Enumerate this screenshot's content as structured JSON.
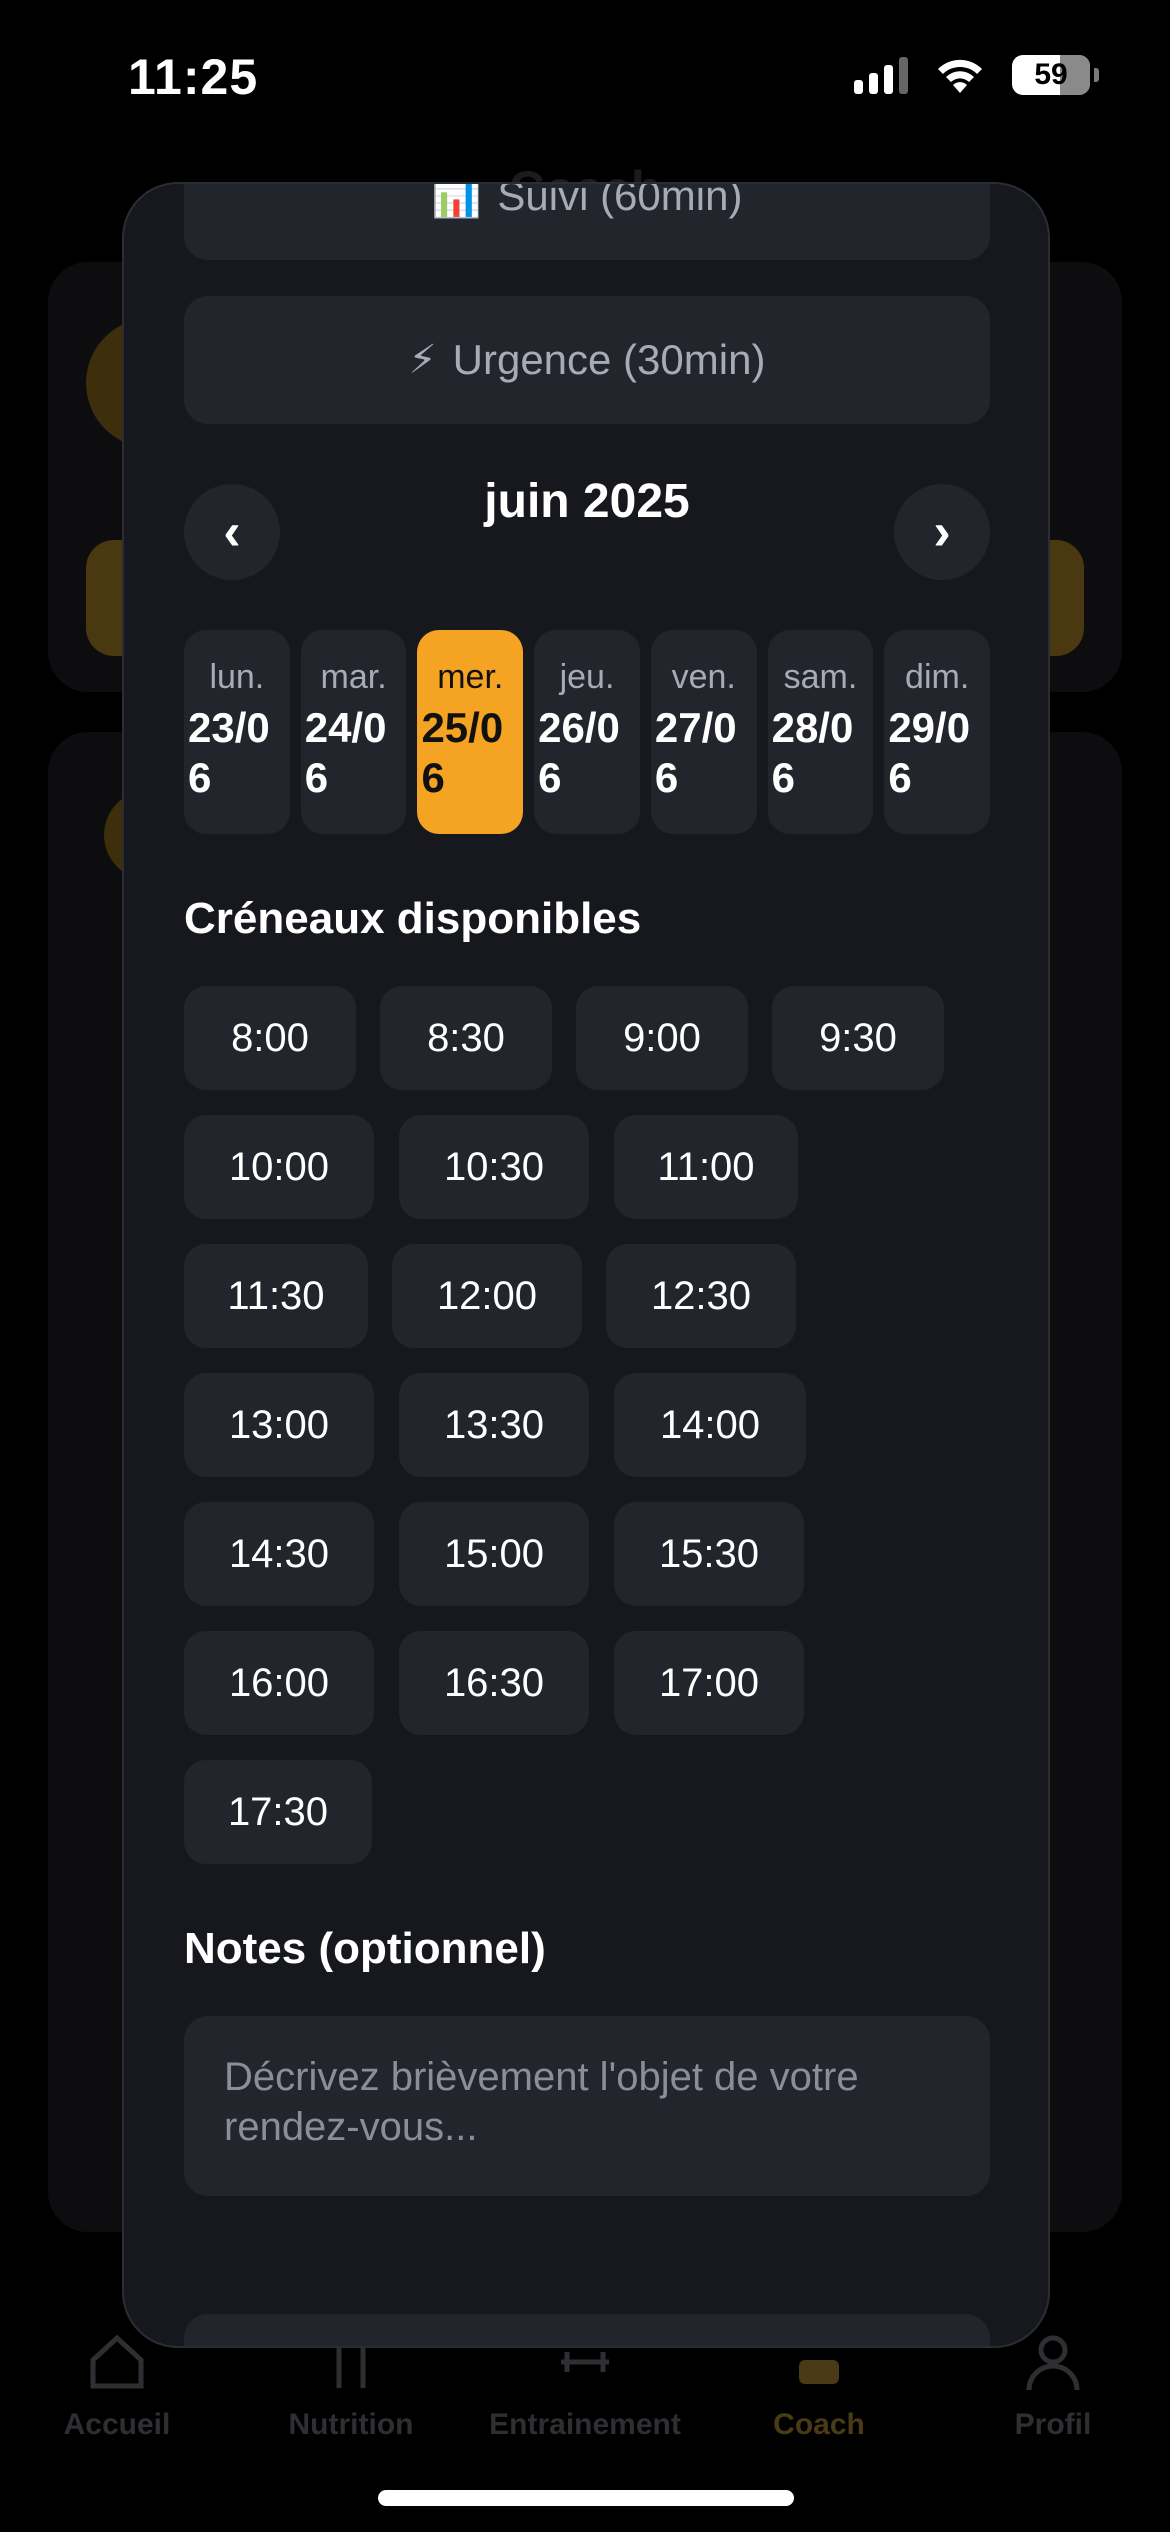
{
  "status_bar": {
    "time": "11:25",
    "battery": "59"
  },
  "background": {
    "header_title": "Coach"
  },
  "modal": {
    "consult_types": [
      {
        "emoji": "📊",
        "label": "Suivi (60min)"
      },
      {
        "emoji": "⚡",
        "label": "Urgence (30min)"
      }
    ],
    "calendar": {
      "month": "juin 2025",
      "prev": "‹",
      "next": "›",
      "days": [
        {
          "name": "lun.",
          "date": "23/06"
        },
        {
          "name": "mar.",
          "date": "24/06"
        },
        {
          "name": "mer.",
          "date": "25/06"
        },
        {
          "name": "jeu.",
          "date": "26/06"
        },
        {
          "name": "ven.",
          "date": "27/06"
        },
        {
          "name": "sam.",
          "date": "28/06"
        },
        {
          "name": "dim.",
          "date": "29/06"
        }
      ],
      "selected_day": "25/06"
    },
    "slots_title": "Créneaux disponibles",
    "slots": [
      "8:00",
      "8:30",
      "9:00",
      "9:30",
      "10:00",
      "10:30",
      "11:00",
      "11:30",
      "12:00",
      "12:30",
      "13:00",
      "13:30",
      "14:00",
      "14:30",
      "15:00",
      "15:30",
      "16:00",
      "16:30",
      "17:00",
      "17:30"
    ],
    "notes_title": "Notes (optionnel)",
    "notes_placeholder": "Décrivez brièvement l'objet de votre rendez-vous..."
  },
  "tab_bar": {
    "items": [
      {
        "label": "Accueil",
        "icon": "home-icon"
      },
      {
        "label": "Nutrition",
        "icon": "fork-knife-icon"
      },
      {
        "label": "Entrainement",
        "icon": "dumbbell-icon"
      },
      {
        "label": "Coach",
        "icon": "coach-icon",
        "active": true
      },
      {
        "label": "Profil",
        "icon": "person-icon"
      }
    ]
  },
  "colors": {
    "accent": "#f4a323",
    "surface": "#22252c",
    "modal_bg": "#16181d"
  }
}
